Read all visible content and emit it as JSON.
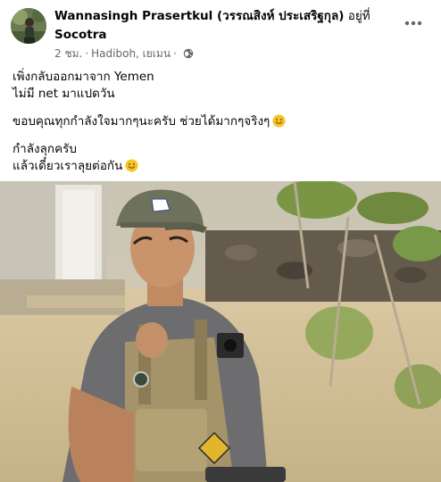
{
  "post": {
    "author": "Wannasingh Prasertkul (วรรณสิงห์ ประเสริฐกุล)",
    "at_label": "อยู่ที่",
    "place": "Socotra",
    "time": "2 ชม.",
    "location": "Hadiboh, เยเมน",
    "privacy_icon": "globe-icon",
    "more_icon": "more-horizontal-icon",
    "paragraphs": [
      {
        "lines": [
          "เพิ่งกลับออกมาจาก Yemen",
          "ไม่มี net มาแปดวัน"
        ]
      },
      {
        "lines": [
          "ขอบคุณทุกกำลังใจมากๆนะครับ ช่วยได้มากๆจริงๆ"
        ]
      },
      {
        "lines": [
          "กำลังลุกครับ",
          "แล้วเดี๋ยวเราลุยต่อกัน"
        ]
      }
    ],
    "emoji_icon": "smiling-face-emoji",
    "photo_icon": "post-photo"
  },
  "colors": {
    "text_primary": "#050505",
    "text_secondary": "#65676b",
    "emoji_yellow": "#f7c325"
  }
}
